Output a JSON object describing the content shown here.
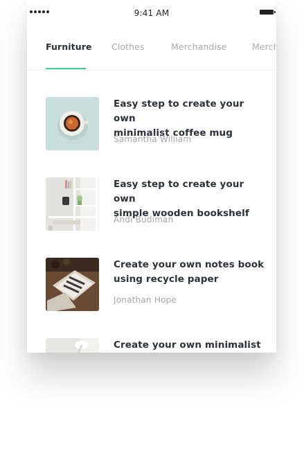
{
  "status_bar": {
    "time": "9:41 AM",
    "signal_icon": "signal-dots-icon",
    "battery_icon": "battery-icon"
  },
  "tabs": [
    {
      "label": "Furniture",
      "active": true
    },
    {
      "label": "Clothes",
      "active": false
    },
    {
      "label": "Merchandise",
      "active": false
    },
    {
      "label": "Merch",
      "active": false
    }
  ],
  "accent_color": "#3fcf91",
  "articles": [
    {
      "title_line1": "Easy step to create your own",
      "title_line2": "minimalist coffee mug",
      "author": "Samantha William"
    },
    {
      "title_line1": "Easy step to create your own",
      "title_line2": "simple wooden bookshelf",
      "author": "Andi Budiman"
    },
    {
      "title_line1": "Create your own notes book",
      "title_line2": "using recycle paper",
      "author": "Jonathan Hope"
    },
    {
      "title_line1": "Create your own minimalist",
      "title_line2": "",
      "author": ""
    }
  ]
}
